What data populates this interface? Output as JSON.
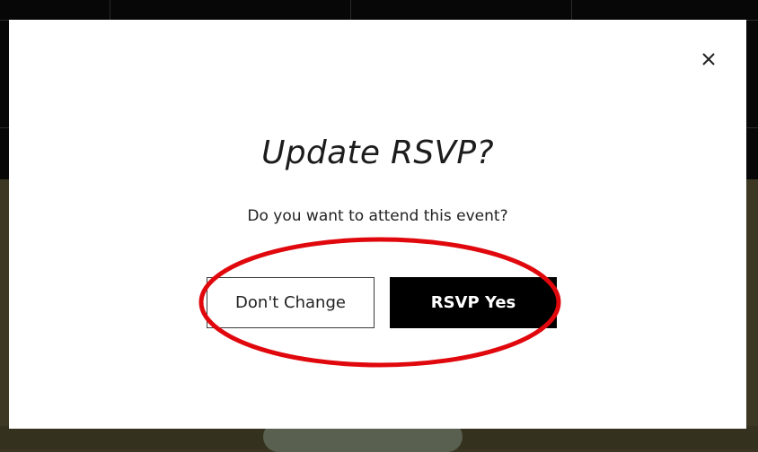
{
  "dialog": {
    "title": "Update RSVP?",
    "message": "Do you want to attend this event?",
    "close_icon": "close-icon",
    "secondary_button_label": "Don't Change",
    "primary_button_label": "RSVP Yes"
  },
  "annotation": {
    "shape": "ellipse",
    "color": "#e0080d"
  },
  "colors": {
    "modal_background": "#ffffff",
    "primary_button": "#000000",
    "backdrop": "#3b3522"
  }
}
